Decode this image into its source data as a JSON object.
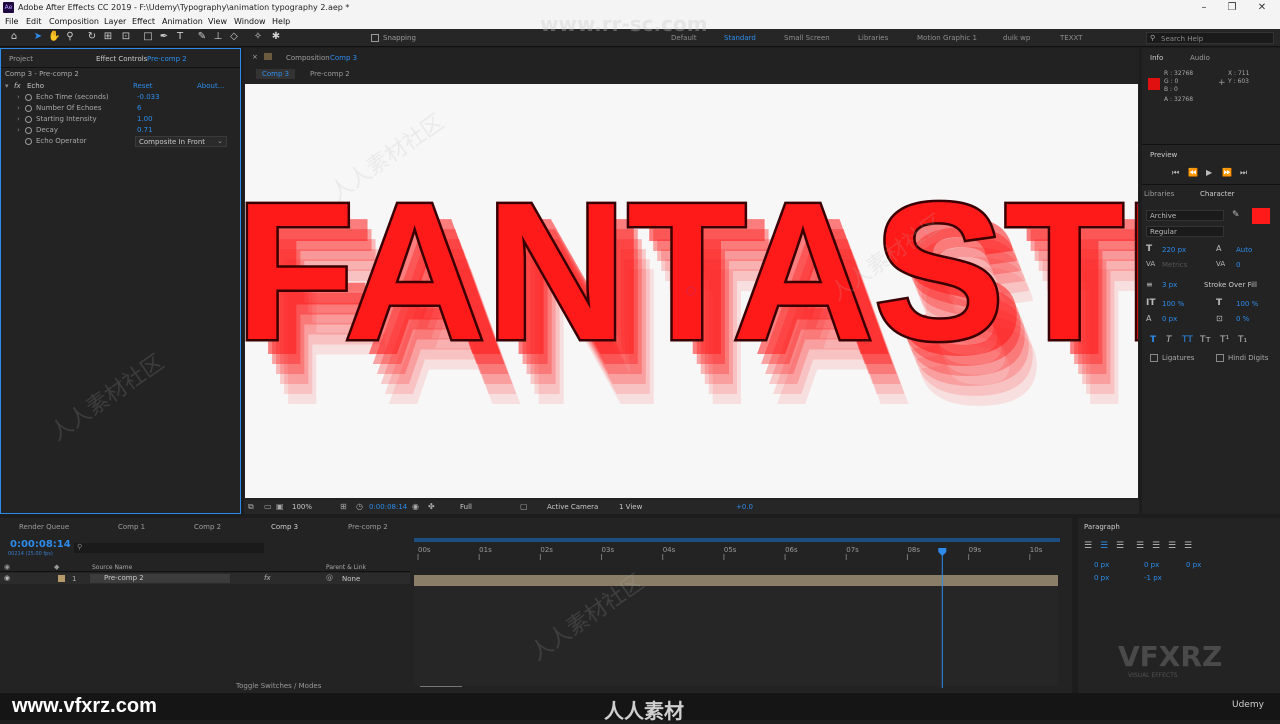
{
  "app": {
    "title": "Adobe After Effects CC 2019 - F:\\Udemy\\Typography\\animation typography 2.aep *",
    "icon": "ae-logo-icon"
  },
  "menu": [
    "File",
    "Edit",
    "Composition",
    "Layer",
    "Effect",
    "Animation",
    "View",
    "Window",
    "Help"
  ],
  "toolbar": {
    "snapping": "Snapping",
    "workspaces": [
      "Default",
      "Standard",
      "Small Screen",
      "Libraries",
      "Motion Graphic 1",
      "duik wp",
      "TEXXT"
    ],
    "search": "Search Help"
  },
  "watermark": {
    "top": "www.rr-sc.com",
    "logo": "VFXRZ",
    "logo_sub": "VISUAL EFFECTS",
    "site": "www.vfxrz.com",
    "cn": "人人素材",
    "cn2": "人人素材社区",
    "udemy": "Udemy"
  },
  "effect_panel": {
    "tabs": [
      "Project",
      "Effect Controls",
      "Pre-comp 2"
    ],
    "header": "Comp 3 - Pre-comp 2",
    "effect": {
      "name": "Echo",
      "reset": "Reset",
      "about": "About..."
    },
    "props": [
      {
        "label": "Echo Time (seconds)",
        "value": "-0.033"
      },
      {
        "label": "Number Of Echoes",
        "value": "6"
      },
      {
        "label": "Starting Intensity",
        "value": "1.00"
      },
      {
        "label": "Decay",
        "value": "0.71"
      },
      {
        "label": "Echo Operator",
        "value": "Composite In Front"
      }
    ]
  },
  "composition": {
    "tab_prefix": "Composition",
    "tab_name": "Comp 3",
    "breadcrumbs": [
      "Comp 3",
      "Pre-comp 2"
    ],
    "canvas_text": "FANTASTIC",
    "text_color": "#ff1a1a",
    "viewer": {
      "zoom": "100%",
      "time": "0:00:08:14",
      "res": "Full",
      "camera": "Active Camera",
      "views": "1 View",
      "exposure": "+0.0"
    }
  },
  "info": {
    "tabs": [
      "Info",
      "Audio"
    ],
    "r": "R : 32768",
    "g": "G : 0",
    "b": "B : 0",
    "a": "A : 32768",
    "x": "X : 711",
    "y": "Y : 603",
    "swatch": "#e01010"
  },
  "preview": {
    "title": "Preview"
  },
  "character": {
    "tabs": [
      "Libraries",
      "Character"
    ],
    "font": "Archive",
    "style": "Regular",
    "size": "220 px",
    "leading": "Auto",
    "kerning": "Metrics",
    "tracking": "0",
    "stroke": "3 px",
    "stroke_mode": "Stroke Over Fill",
    "vscale": "100 %",
    "hscale": "100 %",
    "baseline": "0 px",
    "tsume": "0 %",
    "ligatures": "Ligatures",
    "hindi": "Hindi Digits",
    "fill": "#ff1a1a"
  },
  "timeline": {
    "tabs": [
      "Render Queue",
      "Comp 1",
      "Comp 2",
      "Comp 3",
      "Pre-comp 2"
    ],
    "timecode": "0:00:08:14",
    "frames": "00214 (25.00 fps)",
    "cols": {
      "source": "Source Name",
      "parent": "Parent & Link"
    },
    "layer": {
      "num": "1",
      "name": "Pre-comp 2",
      "parent": "None"
    },
    "ticks": [
      "00s",
      "01s",
      "02s",
      "03s",
      "04s",
      "05s",
      "06s",
      "07s",
      "08s",
      "09s",
      "10s"
    ],
    "playhead": 8.57,
    "duration": 10,
    "footer": "Toggle Switches / Modes"
  },
  "paragraph": {
    "title": "Paragraph",
    "v1": "0 px",
    "v2": "0 px",
    "v3": "0 px",
    "v4": "0 px",
    "v5": "-1 px"
  }
}
